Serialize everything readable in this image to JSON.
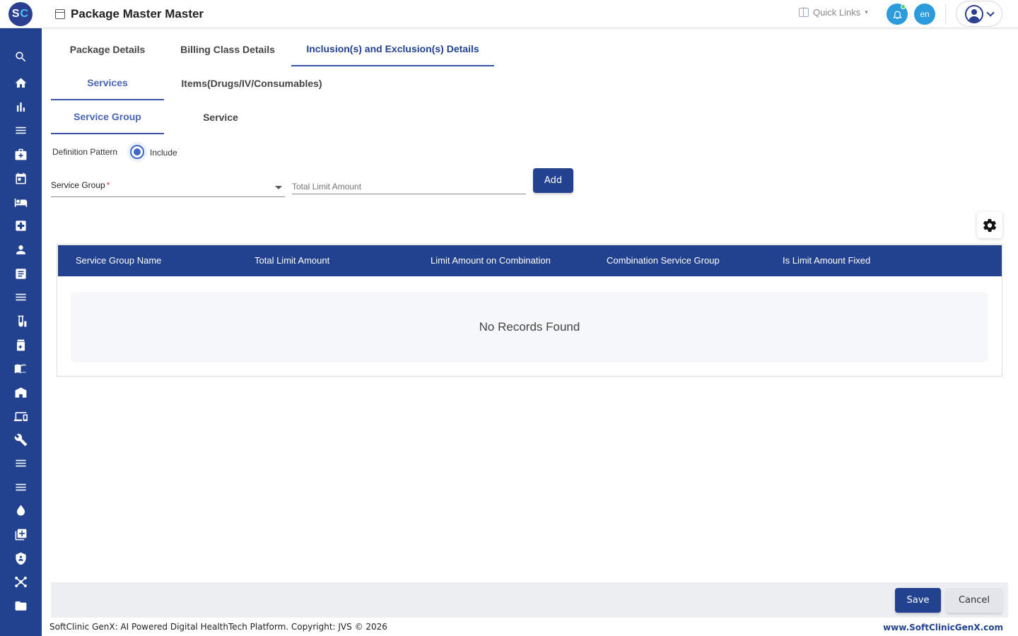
{
  "header": {
    "logo_s": "S",
    "logo_c": "C",
    "title": "Package Master Master",
    "quick_links": "Quick Links",
    "language": "en"
  },
  "sidebar": {
    "items": [
      {
        "icon": "search-icon"
      },
      {
        "icon": "home-icon"
      },
      {
        "icon": "bar-chart-icon"
      },
      {
        "icon": "menu-icon"
      },
      {
        "icon": "medical-bag-icon"
      },
      {
        "icon": "calendar-icon"
      },
      {
        "icon": "bed-icon"
      },
      {
        "icon": "medical-cross-icon"
      },
      {
        "icon": "person-icon"
      },
      {
        "icon": "receipt-icon"
      },
      {
        "icon": "menu-icon"
      },
      {
        "icon": "lab-icon"
      },
      {
        "icon": "pharmacy-icon"
      },
      {
        "icon": "book-icon"
      },
      {
        "icon": "store-icon"
      },
      {
        "icon": "devices-icon"
      },
      {
        "icon": "wrench-icon"
      },
      {
        "icon": "menu-icon"
      },
      {
        "icon": "menu-icon"
      },
      {
        "icon": "blood-drop-icon"
      },
      {
        "icon": "add-box-icon"
      },
      {
        "icon": "shield-icon"
      },
      {
        "icon": "network-icon"
      },
      {
        "icon": "folder-icon"
      }
    ]
  },
  "tabs": {
    "main": [
      "Package Details",
      "Billing Class Details",
      "Inclusion(s) and Exclusion(s) Details"
    ],
    "level2": [
      "Services",
      "Items(Drugs/IV/Consumables)"
    ],
    "level3": [
      "Service Group",
      "Service"
    ]
  },
  "form": {
    "definition_pattern_label": "Definition Pattern",
    "radio_label": "Include",
    "service_group_label": "Service Group",
    "required_mark": "*",
    "total_limit_label": "Total Limit Amount",
    "add_button": "Add"
  },
  "table": {
    "columns": [
      "Service Group Name",
      "Total Limit Amount",
      "Limit Amount on Combination",
      "Combination Service Group",
      "Is Limit Amount Fixed"
    ],
    "empty_text": "No Records Found"
  },
  "actions": {
    "save": "Save",
    "cancel": "Cancel"
  },
  "footer": {
    "copyright": "SoftClinic GenX: AI Powered Digital HealthTech Platform. Copyright: JVS © 2026",
    "link": "www.SoftClinicGenX.com"
  },
  "colors": {
    "primary": "#22428f",
    "accent": "#2b9bdc",
    "radio": "#3f67c9",
    "notification_dot": "#47d16c"
  }
}
